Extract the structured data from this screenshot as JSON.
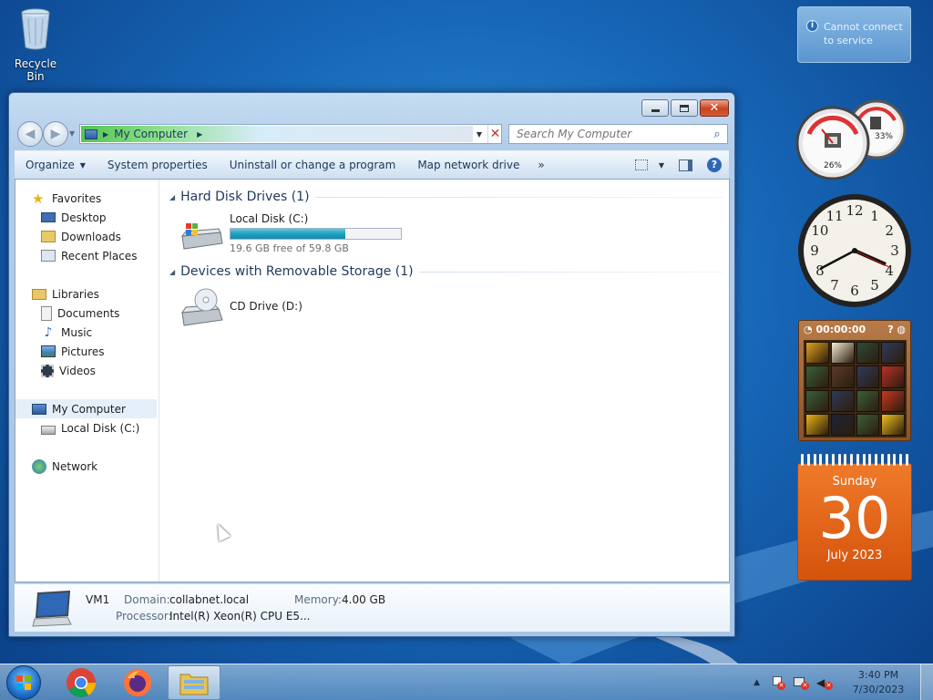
{
  "desktop": {
    "recycle_bin_label": "Recycle Bin"
  },
  "notification": {
    "text": "Cannot connect to service"
  },
  "explorer": {
    "address": {
      "location": "My Computer"
    },
    "search": {
      "placeholder": "Search My Computer"
    },
    "commands": {
      "organize": "Organize",
      "system_properties": "System properties",
      "uninstall": "Uninstall or change a program",
      "map_drive": "Map network drive",
      "more": "»"
    },
    "nav": {
      "favorites": "Favorites",
      "desktop": "Desktop",
      "downloads": "Downloads",
      "recent_places": "Recent Places",
      "libraries": "Libraries",
      "documents": "Documents",
      "music": "Music",
      "pictures": "Pictures",
      "videos": "Videos",
      "my_computer": "My Computer",
      "local_disk": "Local Disk (C:)",
      "network": "Network"
    },
    "groups": {
      "hard_disks": "Hard Disk Drives (1)",
      "removable": "Devices with Removable Storage (1)"
    },
    "drives": {
      "c": {
        "name": "Local Disk (C:)",
        "free_text": "19.6 GB free of 59.8 GB",
        "used_fraction": 0.672
      },
      "d": {
        "name": "CD Drive (D:)"
      }
    },
    "details": {
      "computer_name": "VM1",
      "domain_label": "Domain:",
      "domain_value": "collabnet.local",
      "memory_label": "Memory:",
      "memory_value": "4.00 GB",
      "processor_label": "Processor:",
      "processor_value": "Intel(R) Xeon(R) CPU E5..."
    }
  },
  "gadgets": {
    "cpu_meter": {
      "cpu_percent": "26%",
      "ram_percent": "33%"
    },
    "clock": {
      "numerals": [
        "12",
        "1",
        "2",
        "3",
        "4",
        "5",
        "6",
        "7",
        "8",
        "9",
        "10",
        "11"
      ]
    },
    "puzzle": {
      "timer": "00:00:00"
    },
    "calendar": {
      "weekday": "Sunday",
      "day": "30",
      "month_year": "July 2023"
    }
  },
  "taskbar": {
    "time": "3:40 PM",
    "date": "7/30/2023"
  },
  "colors": {
    "accent": "#1ea0c0",
    "calendar": "#e2661a",
    "close_button": "#c8431f"
  }
}
